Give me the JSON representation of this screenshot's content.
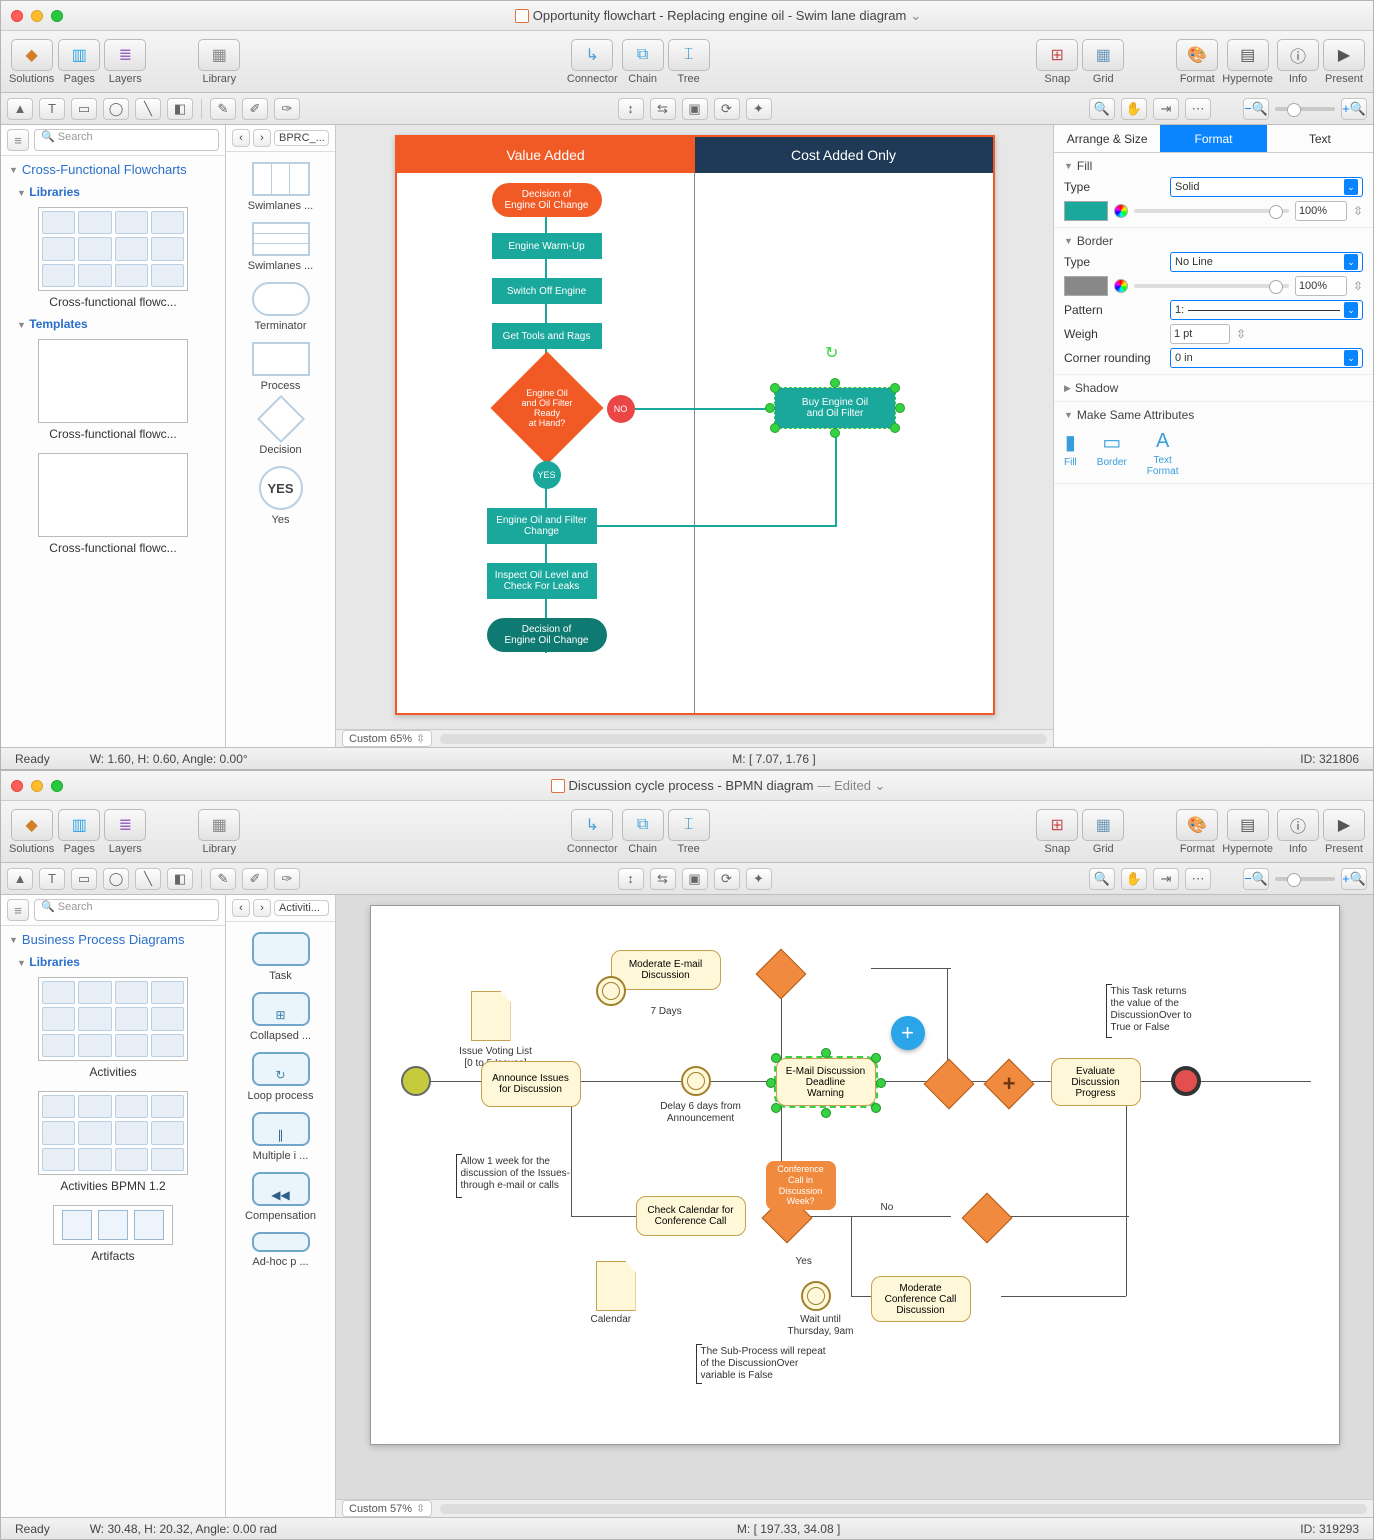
{
  "app1": {
    "title": "Opportunity flowchart - Replacing engine oil - Swim lane diagram",
    "edited_suffix": "⌄",
    "toolbar": {
      "solutions": "Solutions",
      "pages": "Pages",
      "layers": "Layers",
      "library": "Library",
      "connector": "Connector",
      "chain": "Chain",
      "tree": "Tree",
      "snap": "Snap",
      "grid": "Grid",
      "format": "Format",
      "hypernote": "Hypernote",
      "info": "Info",
      "present": "Present"
    },
    "left": {
      "search_placeholder": "Search",
      "section": "Cross-Functional Flowcharts",
      "sub_libraries": "Libraries",
      "sub_templates": "Templates",
      "lib1": "Cross-functional flowc...",
      "tpl1": "Cross-functional flowc...",
      "tpl2": "Cross-functional flowc..."
    },
    "shapes": {
      "crumb": "BPRC_...",
      "swimlanes": "Swimlanes  ...",
      "swimlanes2": "Swimlanes  ...",
      "terminator": "Terminator",
      "process": "Process",
      "decision": "Decision",
      "yes": "YES",
      "yes_lbl": "Yes"
    },
    "lanes": {
      "va": "Value Added",
      "ca": "Cost Added Only"
    },
    "flow": {
      "start": "Decision of\nEngine Oil Change",
      "p1": "Engine Warm-Up",
      "p2": "Switch Off Engine",
      "p3": "Get Tools and Rags",
      "dec": "Engine Oil\nand Oil Filter Ready\nat Hand?",
      "no": "NO",
      "yes": "YES",
      "buy": "Buy Engine Oil\nand Oil Filter",
      "p4": "Engine Oil and Filter\nChange",
      "p5": "Inspect Oil Level and\nCheck For Leaks",
      "end": "Decision of\nEngine Oil Change"
    },
    "zoom": "Custom 65%",
    "status": {
      "ready": "Ready",
      "wh": "W: 1.60,  H: 0.60,  Angle: 0.00°",
      "m": "M: [ 7.07, 1.76 ]",
      "id": "ID: 321806"
    },
    "right": {
      "tabs": {
        "as": "Arrange & Size",
        "fmt": "Format",
        "txt": "Text"
      },
      "fill": "Fill",
      "type": "Type",
      "solid": "Solid",
      "hundred": "100%",
      "border": "Border",
      "noline": "No Line",
      "pattern": "Pattern",
      "pattern_val": "1:",
      "weigh": "Weigh",
      "weigh_val": "1 pt",
      "corner": "Corner rounding",
      "corner_val": "0 in",
      "shadow": "Shadow",
      "msa": "Make Same Attributes",
      "ico_fill": "Fill",
      "ico_border": "Border",
      "ico_tf": "Text\nFormat"
    }
  },
  "app2": {
    "title": "Discussion cycle process - BPMN diagram",
    "edited": " — Edited ⌄",
    "toolbar": {
      "solutions": "Solutions",
      "pages": "Pages",
      "layers": "Layers",
      "library": "Library",
      "connector": "Connector",
      "chain": "Chain",
      "tree": "Tree",
      "snap": "Snap",
      "grid": "Grid",
      "format": "Format",
      "hypernote": "Hypernote",
      "info": "Info",
      "present": "Present"
    },
    "left": {
      "search_placeholder": "Search",
      "section": "Business Process Diagrams",
      "sub_libraries": "Libraries",
      "lib1": "Activities",
      "lib2": "Activities BPMN 1.2",
      "lib3": "Artifacts"
    },
    "shapes": {
      "crumb": "Activiti...",
      "task": "Task",
      "collapsed": "Collapsed  ...",
      "loop": "Loop process",
      "multi": "Multiple i ...",
      "comp": "Compensation",
      "adhoc": "Ad-hoc p ..."
    },
    "diagram": {
      "issue_list": "Issue Voting List\n[0 to 5 Issues]",
      "announce": "Announce Issues\nfor Discussion",
      "moderate_email": "Moderate E-mail\nDiscussion",
      "seven": "7 Days",
      "delay": "Delay 6 days from\nAnnouncement",
      "email_dw": "E-Mail Discussion\nDeadline\nWarning",
      "allow": "Allow 1 week for the\ndiscussion of the Issues-\nthrough e-mail or calls",
      "check_cal": "Check Calendar for\nConference Call",
      "conf_q": "Conference\nCall in Discussion\nWeek?",
      "yes": "Yes",
      "no": "No",
      "wait": "Wait until\nThursday, 9am",
      "mod_conf": "Moderate\nConference Call\nDiscussion",
      "calendar": "Calendar",
      "subproc": "The Sub-Process will repeat\nof the DiscussionOver\nvariable is False",
      "eval": "Evaluate\nDiscussion\nProgress",
      "returns": "This Task returns\nthe value of the\nDiscussionOver to\nTrue or False"
    },
    "zoom": "Custom 57%",
    "status": {
      "ready": "Ready",
      "wh": "W: 30.48,  H: 20.32,  Angle: 0.00 rad",
      "m": "M: [ 197.33, 34.08 ]",
      "id": "ID: 319293"
    }
  }
}
